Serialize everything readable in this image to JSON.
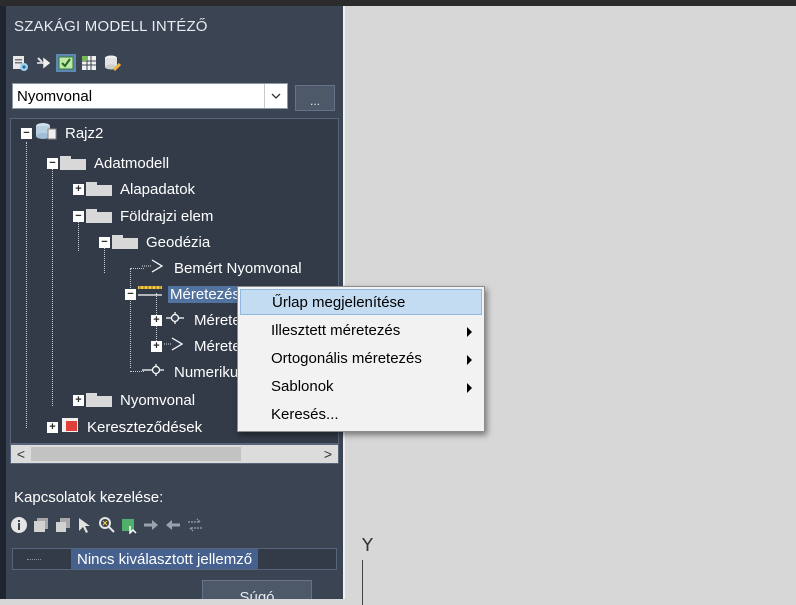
{
  "panel": {
    "title": "SZAKÁGI MODELL INTÉZŐ"
  },
  "toolbar": {
    "icons": [
      "database-settings-icon",
      "pin-icon",
      "zoom-refresh-icon",
      "grid-table-icon",
      "database-edit-icon"
    ],
    "active_index": 2
  },
  "combo": {
    "value": "Nyomvonal",
    "more_label": "..."
  },
  "tree": {
    "nodes": [
      {
        "label": "Rajz2",
        "expander": "minus",
        "icon": "database-icon",
        "kind": "root"
      },
      {
        "label": "Adatmodell",
        "expander": "minus",
        "icon": "folder-icon"
      },
      {
        "label": "Alapadatok",
        "expander": "plus",
        "icon": "folder-icon"
      },
      {
        "label": "Földrajzi elem",
        "expander": "minus",
        "icon": "folder-icon"
      },
      {
        "label": "Geodézia",
        "expander": "minus",
        "icon": "folder-icon"
      },
      {
        "label": "Bemért Nyomvonal",
        "expander": "",
        "icon": "line-feature-icon"
      },
      {
        "label": "Méretezés",
        "expander": "minus",
        "icon": "dimension-icon",
        "selected": true
      },
      {
        "label": "Méretezés",
        "expander": "plus",
        "icon": "point-feature-icon"
      },
      {
        "label": "Méretezés",
        "expander": "plus",
        "icon": "line-feature-icon"
      },
      {
        "label": "Numerikus méretezés",
        "expander": "",
        "icon": "point-feature-icon"
      },
      {
        "label": "Nyomvonal",
        "expander": "plus",
        "icon": "folder-icon"
      },
      {
        "label": "Kereszteződések",
        "expander": "plus",
        "icon": "polygon-feature-icon"
      }
    ]
  },
  "scroll": {
    "left": "<",
    "right": ">"
  },
  "connections": {
    "label": "Kapcsolatok kezelése:",
    "icons": [
      "info-icon",
      "stack-icon",
      "stack-link-icon",
      "select-icon",
      "zoom-icon",
      "add-cube-icon",
      "arrow-right-icon",
      "arrow-left-icon",
      "relation-icon"
    ],
    "empty_text": "Nincs kiválasztott jellemző"
  },
  "help_button": "Súgó",
  "viewport": {
    "ucs_label": "Y"
  },
  "context_menu": {
    "items": [
      {
        "label": "Űrlap megjelenítése",
        "submenu": false,
        "hover": true
      },
      {
        "label": "Illesztett méretezés",
        "submenu": true
      },
      {
        "label": "Ortogonális méretezés",
        "submenu": true
      },
      {
        "label": "Sablonok",
        "submenu": true
      },
      {
        "label": "Keresés...",
        "submenu": false
      }
    ]
  }
}
